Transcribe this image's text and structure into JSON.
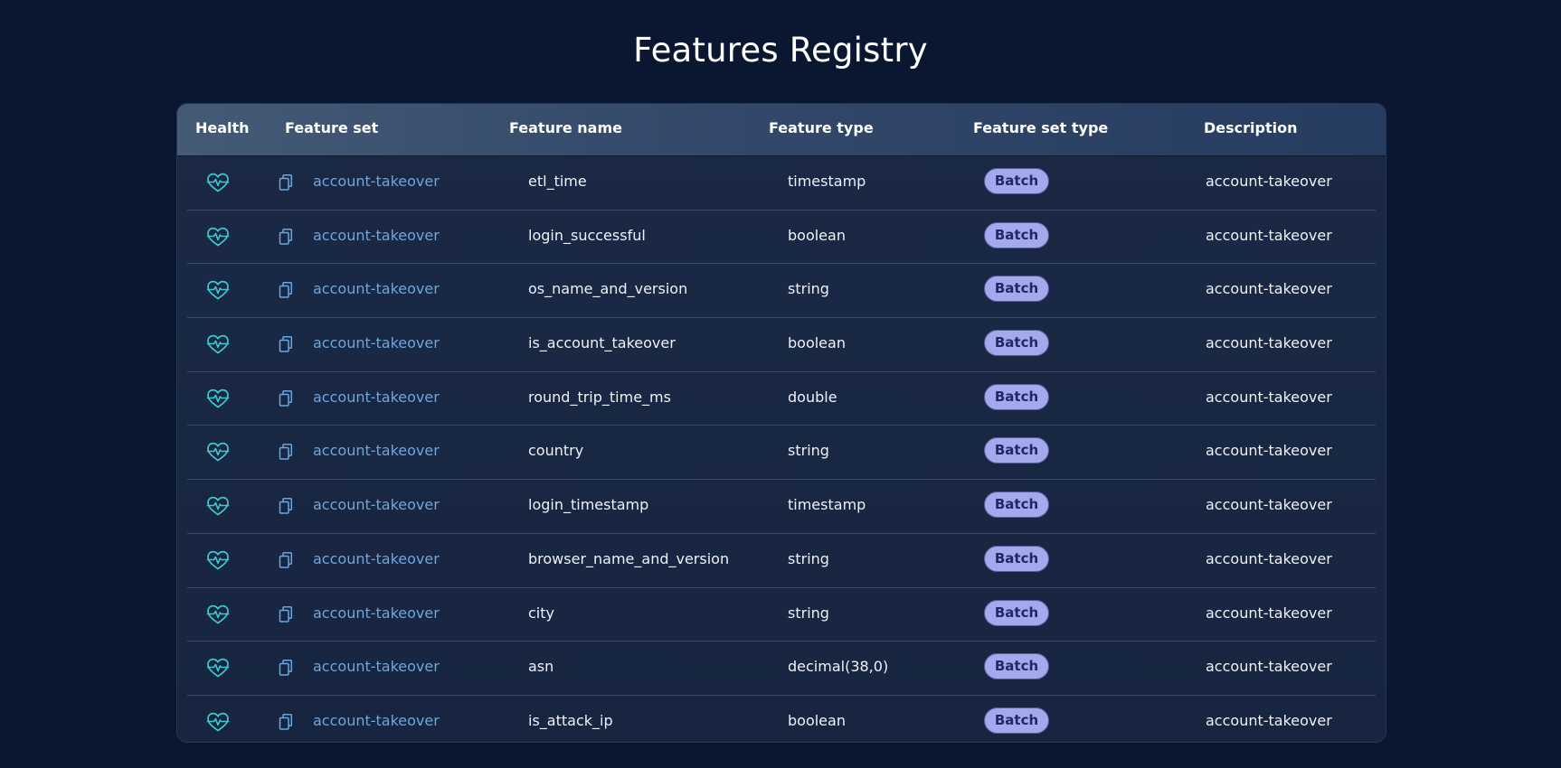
{
  "page": {
    "title": "Features Registry"
  },
  "table": {
    "headers": {
      "health": "Health",
      "feature_set": "Feature set",
      "feature_name": "Feature name",
      "feature_type": "Feature type",
      "feature_set_type": "Feature set type",
      "description": "Description"
    },
    "rows": [
      {
        "feature_set": "account-takeover",
        "feature_name": "etl_time",
        "feature_type": "timestamp",
        "feature_set_type": "Batch",
        "description": "account-takeover"
      },
      {
        "feature_set": "account-takeover",
        "feature_name": "login_successful",
        "feature_type": "boolean",
        "feature_set_type": "Batch",
        "description": "account-takeover"
      },
      {
        "feature_set": "account-takeover",
        "feature_name": "os_name_and_version",
        "feature_type": "string",
        "feature_set_type": "Batch",
        "description": "account-takeover"
      },
      {
        "feature_set": "account-takeover",
        "feature_name": "is_account_takeover",
        "feature_type": "boolean",
        "feature_set_type": "Batch",
        "description": "account-takeover"
      },
      {
        "feature_set": "account-takeover",
        "feature_name": "round_trip_time_ms",
        "feature_type": "double",
        "feature_set_type": "Batch",
        "description": "account-takeover"
      },
      {
        "feature_set": "account-takeover",
        "feature_name": "country",
        "feature_type": "string",
        "feature_set_type": "Batch",
        "description": "account-takeover"
      },
      {
        "feature_set": "account-takeover",
        "feature_name": "login_timestamp",
        "feature_type": "timestamp",
        "feature_set_type": "Batch",
        "description": "account-takeover"
      },
      {
        "feature_set": "account-takeover",
        "feature_name": "browser_name_and_version",
        "feature_type": "string",
        "feature_set_type": "Batch",
        "description": "account-takeover"
      },
      {
        "feature_set": "account-takeover",
        "feature_name": "city",
        "feature_type": "string",
        "feature_set_type": "Batch",
        "description": "account-takeover"
      },
      {
        "feature_set": "account-takeover",
        "feature_name": "asn",
        "feature_type": "decimal(38,0)",
        "feature_set_type": "Batch",
        "description": "account-takeover"
      },
      {
        "feature_set": "account-takeover",
        "feature_name": "is_attack_ip",
        "feature_type": "boolean",
        "feature_set_type": "Batch",
        "description": "account-takeover"
      }
    ]
  },
  "icons": {
    "health": "heart-pulse-icon",
    "feature_set": "copy-icon"
  },
  "colors": {
    "background": "#0a1730",
    "link": "#6aa7e0",
    "health_icon": "#3ec9cf",
    "badge_bg": "#a4a9ee",
    "badge_text": "#20286a"
  }
}
